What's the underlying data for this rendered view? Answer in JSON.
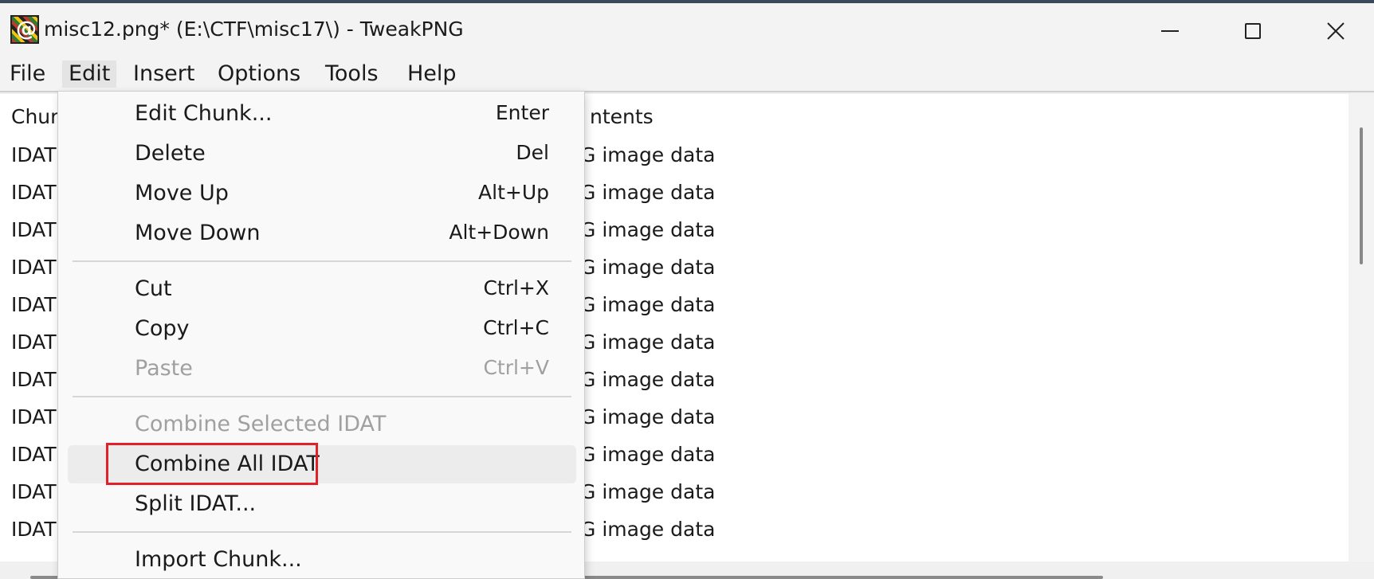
{
  "window": {
    "title": "misc12.png* (E:\\CTF\\misc17\\) - TweakPNG",
    "icon": "tweakpng-app-icon",
    "controls": [
      "minimize-icon",
      "maximize-icon",
      "close-icon"
    ]
  },
  "menubar": {
    "items": [
      {
        "label": "File"
      },
      {
        "label": "Edit"
      },
      {
        "label": "Insert"
      },
      {
        "label": "Options"
      },
      {
        "label": "Tools"
      },
      {
        "label": "Help"
      }
    ]
  },
  "list": {
    "headers": {
      "chunk": "Chur",
      "contents": "ntents"
    },
    "rows": [
      {
        "chunk": "IDAT",
        "contents": "G image data"
      },
      {
        "chunk": "IDAT",
        "contents": "G image data"
      },
      {
        "chunk": "IDAT",
        "contents": "G image data"
      },
      {
        "chunk": "IDAT",
        "contents": "G image data"
      },
      {
        "chunk": "IDAT",
        "contents": "G image data"
      },
      {
        "chunk": "IDAT",
        "contents": "G image data"
      },
      {
        "chunk": "IDAT",
        "contents": "G image data"
      },
      {
        "chunk": "IDAT",
        "contents": "G image data"
      },
      {
        "chunk": "IDAT",
        "contents": "G image data"
      },
      {
        "chunk": "IDAT",
        "contents": "G image data"
      },
      {
        "chunk": "IDAT",
        "contents": "G image data"
      }
    ]
  },
  "edit_menu": {
    "items": [
      {
        "label": "Edit Chunk...",
        "shortcut": "Enter",
        "enabled": true
      },
      {
        "label": "Delete",
        "shortcut": "Del",
        "enabled": true
      },
      {
        "label": "Move Up",
        "shortcut": "Alt+Up",
        "enabled": true
      },
      {
        "label": "Move Down",
        "shortcut": "Alt+Down",
        "enabled": true
      },
      {
        "label": "Cut",
        "shortcut": "Ctrl+X",
        "enabled": true
      },
      {
        "label": "Copy",
        "shortcut": "Ctrl+C",
        "enabled": true
      },
      {
        "label": "Paste",
        "shortcut": "Ctrl+V",
        "enabled": false
      },
      {
        "label": "Combine Selected IDAT",
        "shortcut": "",
        "enabled": false
      },
      {
        "label": "Combine All IDAT",
        "shortcut": "",
        "enabled": true
      },
      {
        "label": "Split IDAT...",
        "shortcut": "",
        "enabled": true
      },
      {
        "label": "Import Chunk...",
        "shortcut": "",
        "enabled": true
      }
    ],
    "highlight_color": "#e2202a"
  }
}
